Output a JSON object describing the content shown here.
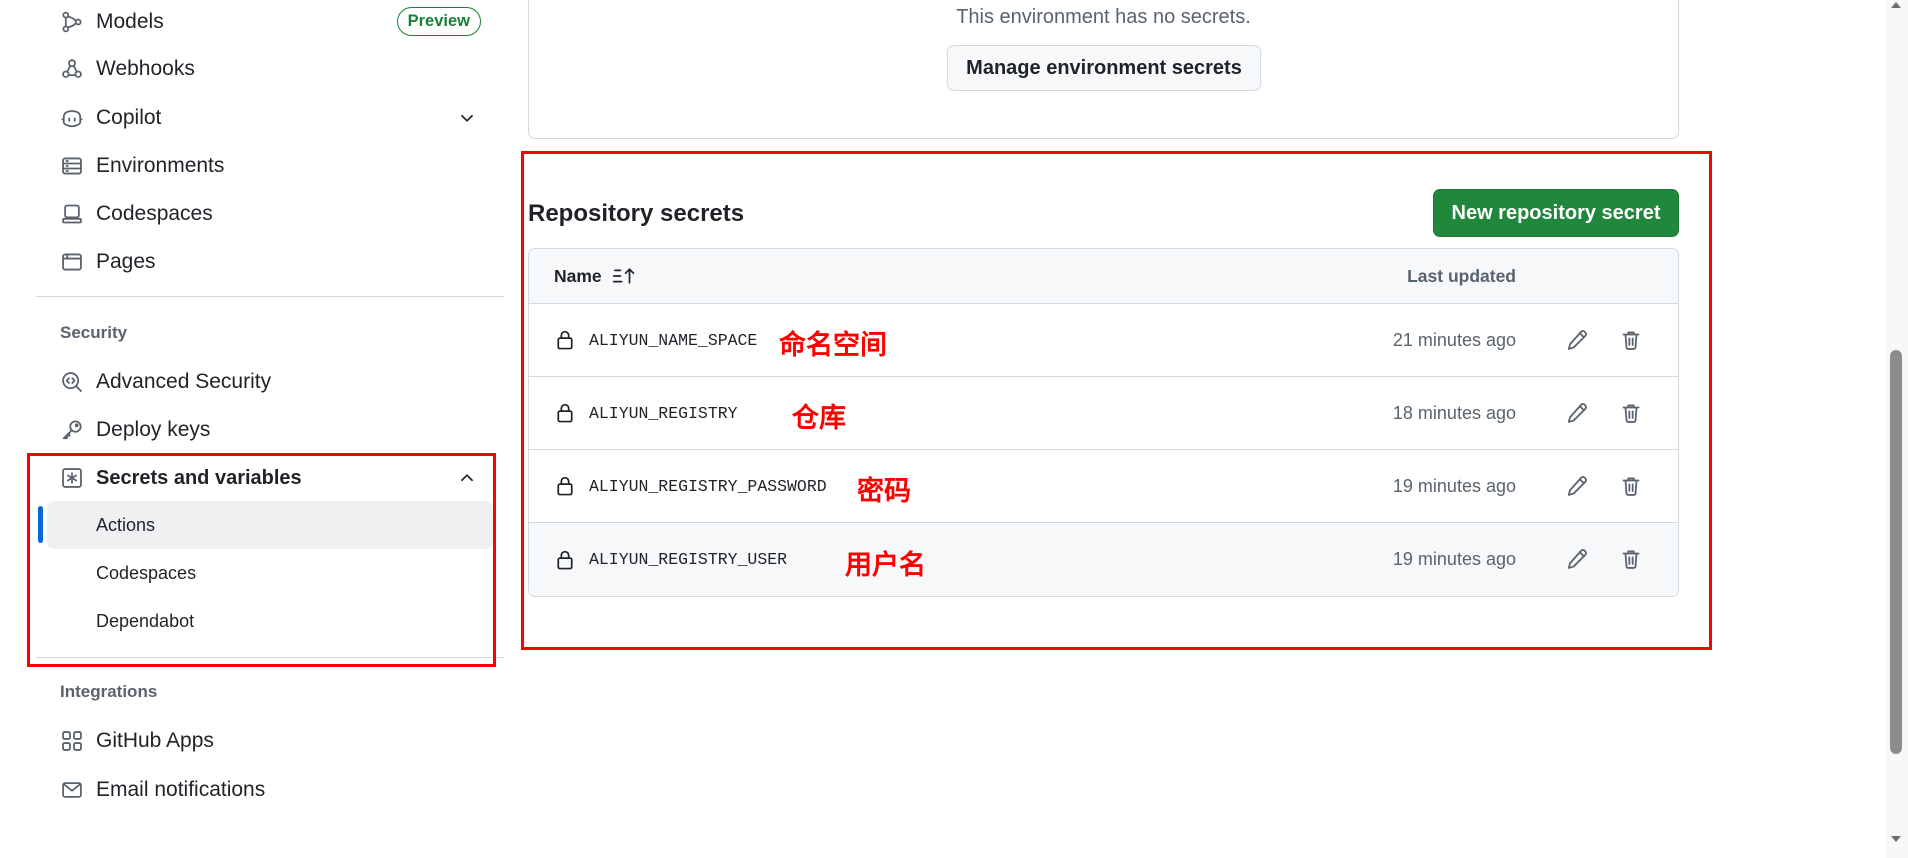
{
  "sidebar": {
    "items": [
      {
        "label": "Models",
        "icon": "models-icon",
        "badge": "Preview"
      },
      {
        "label": "Webhooks",
        "icon": "webhook-icon"
      },
      {
        "label": "Copilot",
        "icon": "copilot-icon",
        "expanded": false
      },
      {
        "label": "Environments",
        "icon": "server-icon"
      },
      {
        "label": "Codespaces",
        "icon": "codespaces-icon"
      },
      {
        "label": "Pages",
        "icon": "browser-icon"
      }
    ],
    "security": {
      "heading": "Security",
      "items": [
        {
          "label": "Advanced Security",
          "icon": "codescan-icon"
        },
        {
          "label": "Deploy keys",
          "icon": "key-icon"
        },
        {
          "label": "Secrets and variables",
          "icon": "key-asterisk-icon",
          "expanded": true,
          "children": [
            {
              "label": "Actions",
              "selected": true
            },
            {
              "label": "Codespaces",
              "selected": false
            },
            {
              "label": "Dependabot",
              "selected": false
            }
          ]
        }
      ]
    },
    "integrations": {
      "heading": "Integrations",
      "items": [
        {
          "label": "GitHub Apps",
          "icon": "apps-icon"
        },
        {
          "label": "Email notifications",
          "icon": "mail-icon"
        }
      ]
    }
  },
  "environment": {
    "empty_text": "This environment has no secrets.",
    "manage_button": "Manage environment secrets"
  },
  "repository_secrets": {
    "title": "Repository secrets",
    "new_button": "New repository secret",
    "columns": {
      "name": "Name",
      "last_updated": "Last updated",
      "sort_icon": "sort-asc-icon"
    },
    "row_icons": {
      "lead": "lock-icon",
      "edit": "pencil-icon",
      "delete": "trash-icon"
    },
    "rows": [
      {
        "name": "ALIYUN_NAME_SPACE",
        "updated": "21 minutes ago",
        "annotation": "命名空间"
      },
      {
        "name": "ALIYUN_REGISTRY",
        "updated": "18 minutes ago",
        "annotation": "仓库"
      },
      {
        "name": "ALIYUN_REGISTRY_PASSWORD",
        "updated": "19 minutes ago",
        "annotation": "密码"
      },
      {
        "name": "ALIYUN_REGISTRY_USER",
        "updated": "19 minutes ago",
        "annotation": "用户名",
        "hovered": true
      }
    ]
  },
  "colors": {
    "text": "#1f2328",
    "muted": "#59636e",
    "border": "#d1d9e0",
    "accent": "#0969da",
    "primary_button": "#1f883d",
    "badge_green": "#1a7f37",
    "annotation_red": "#ff0000"
  }
}
